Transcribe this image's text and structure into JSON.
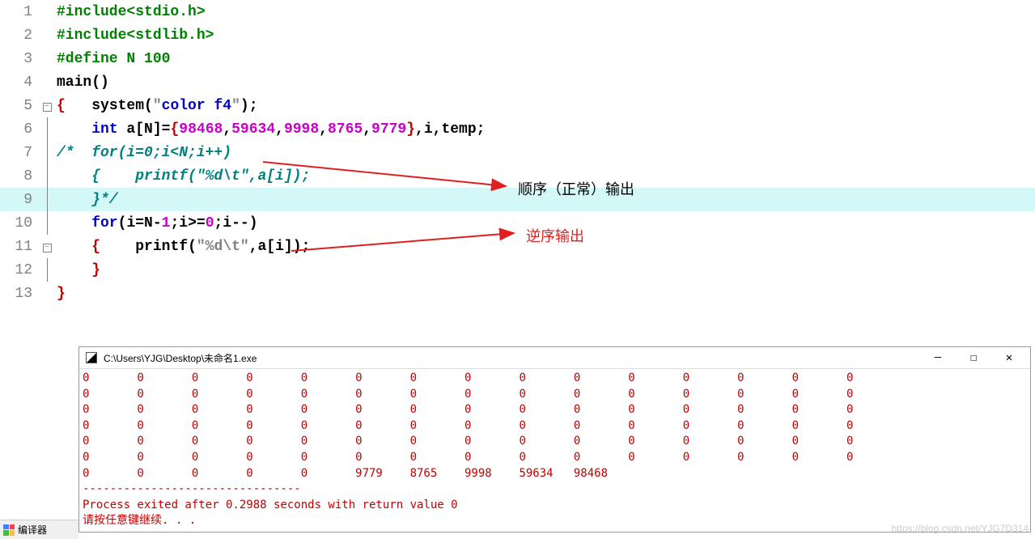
{
  "code": {
    "l1": {
      "num": "1",
      "tokens": [
        {
          "t": "#include<stdio.h>",
          "c": "inc"
        }
      ]
    },
    "l2": {
      "num": "2",
      "tokens": [
        {
          "t": "#include<stdlib.h>",
          "c": "inc"
        }
      ]
    },
    "l3": {
      "num": "3",
      "tokens": [
        {
          "t": "#define N 100",
          "c": "inc"
        }
      ]
    },
    "l4": {
      "num": "4",
      "text": "main()"
    },
    "l5": {
      "num": "5",
      "text": "{   system(\"color f4\");"
    },
    "l6": {
      "num": "6",
      "text": "    int a[N]={98468,59634,9998,8765,9779},i,temp;"
    },
    "l7": {
      "num": "7",
      "text": "/*  for(i=0;i<N;i++)"
    },
    "l8": {
      "num": "8",
      "text": "    {    printf(\"%d\\t\",a[i]);"
    },
    "l9": {
      "num": "9",
      "text": "    }*/"
    },
    "l10": {
      "num": "10",
      "text": "    for(i=N-1;i>=0;i--)"
    },
    "l11": {
      "num": "11",
      "text": "    {    printf(\"%d\\t\",a[i]);"
    },
    "l12": {
      "num": "12",
      "text": "    }"
    },
    "l13": {
      "num": "13",
      "text": "}"
    }
  },
  "annotations": {
    "a1": "顺序（正常）输出",
    "a2": "逆序输出"
  },
  "console": {
    "title": "C:\\Users\\YJG\\Desktop\\未命名1.exe",
    "zeros_row": "0       0       0       0       0       0       0       0       0       0       0       0       0       0       0",
    "last_row": "0       0       0       0       0       9779    8765    9998    59634   98468",
    "divider": "--------------------------------",
    "exit_msg": "Process exited after 0.2988 seconds with return value 0",
    "prompt": "请按任意键继续. . ."
  },
  "bottombar": {
    "label": "编译器"
  },
  "watermark": "https://blog.csdn.net/YJG7D314"
}
